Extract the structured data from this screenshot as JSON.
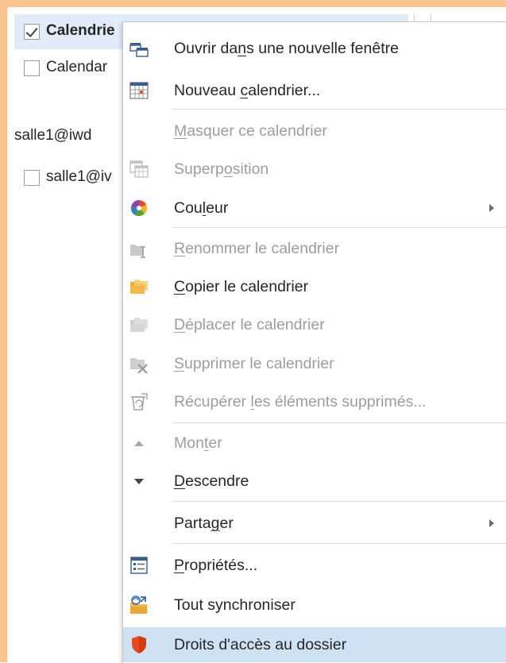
{
  "nav": {
    "items": [
      {
        "label": "Calendrie",
        "checked": true,
        "bold": true
      },
      {
        "label": "Calendar",
        "checked": false,
        "bold": false
      }
    ],
    "account": "salle1@iwd",
    "shared": [
      {
        "label": "salle1@iv",
        "checked": false
      }
    ]
  },
  "menu": {
    "items": [
      {
        "id": "ouvrir",
        "pre": "Ouvrir da",
        "key": "n",
        "post": "s une nouvelle fenêtre",
        "icon": "new-window-icon",
        "enabled": true
      },
      {
        "id": "nouveau",
        "pre": "Nouveau ",
        "key": "c",
        "post": "alendrier...",
        "icon": "new-calendar-icon",
        "enabled": true
      },
      {
        "id": "masquer",
        "pre": "",
        "key": "M",
        "post": "asquer ce calendrier",
        "icon": "",
        "enabled": false
      },
      {
        "id": "superposition",
        "pre": "Superp",
        "key": "o",
        "post": "sition",
        "icon": "overlay-icon",
        "enabled": false
      },
      {
        "id": "couleur",
        "pre": "Cou",
        "key": "l",
        "post": "eur",
        "icon": "color-palette-icon",
        "enabled": true,
        "submenu": true
      },
      {
        "id": "renommer",
        "pre": "",
        "key": "R",
        "post": "enommer le calendrier",
        "icon": "rename-icon",
        "enabled": false
      },
      {
        "id": "copier",
        "pre": "",
        "key": "C",
        "post": "opier le calendrier",
        "icon": "copy-folder-icon",
        "enabled": true
      },
      {
        "id": "deplacer",
        "pre": "",
        "key": "D",
        "post": "éplacer le calendrier",
        "icon": "move-folder-icon",
        "enabled": false
      },
      {
        "id": "supprimer",
        "pre": "",
        "key": "S",
        "post": "upprimer le calendrier",
        "icon": "delete-icon",
        "enabled": false
      },
      {
        "id": "recuperer",
        "pre": "Récupérer ",
        "key": "l",
        "post": "es éléments supprimés...",
        "icon": "recover-icon",
        "enabled": false
      },
      {
        "id": "monter",
        "pre": "Mon",
        "key": "t",
        "post": "er",
        "icon": "move-up-icon",
        "enabled": false
      },
      {
        "id": "descendre",
        "pre": "",
        "key": "D",
        "post": "escendre",
        "icon": "move-down-icon",
        "enabled": true
      },
      {
        "id": "partager",
        "pre": "Parta",
        "key": "g",
        "post": "er",
        "icon": "",
        "enabled": true,
        "submenu": true
      },
      {
        "id": "proprietes",
        "pre": "",
        "key": "P",
        "post": "ropriétés...",
        "icon": "properties-icon",
        "enabled": true
      },
      {
        "id": "synchroniser",
        "pre": "Tout synchroniser",
        "key": "",
        "post": "",
        "icon": "sync-folder-icon",
        "enabled": true
      },
      {
        "id": "droits",
        "pre": "Droits d'accès au dossier",
        "key": "",
        "post": "",
        "icon": "shield-icon",
        "enabled": true,
        "highlighted": true
      }
    ]
  },
  "colors": {
    "focus_frame": "#f9c48f",
    "highlight": "#cfe2f4",
    "shield": "#e8491d"
  }
}
